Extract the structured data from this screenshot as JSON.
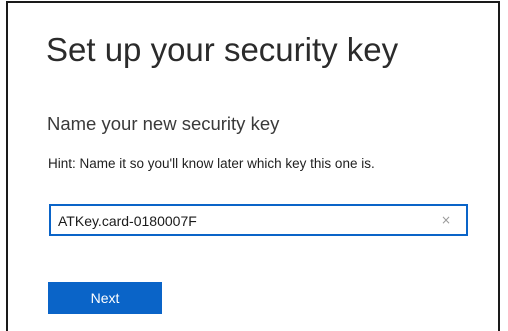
{
  "dialog": {
    "title": "Set up your security key",
    "subtitle": "Name your new security key",
    "hint": "Hint: Name it so you'll know later which key this one is."
  },
  "key_name_field": {
    "value": "ATKey.card-0180007F",
    "clear_glyph": "×",
    "focused": true
  },
  "buttons": {
    "next_label": "Next"
  },
  "colors": {
    "accent": "#0a64c8",
    "border": "#1a1a1a",
    "text": "#2b2b2b"
  },
  "icons": {
    "clear": "close-icon"
  }
}
